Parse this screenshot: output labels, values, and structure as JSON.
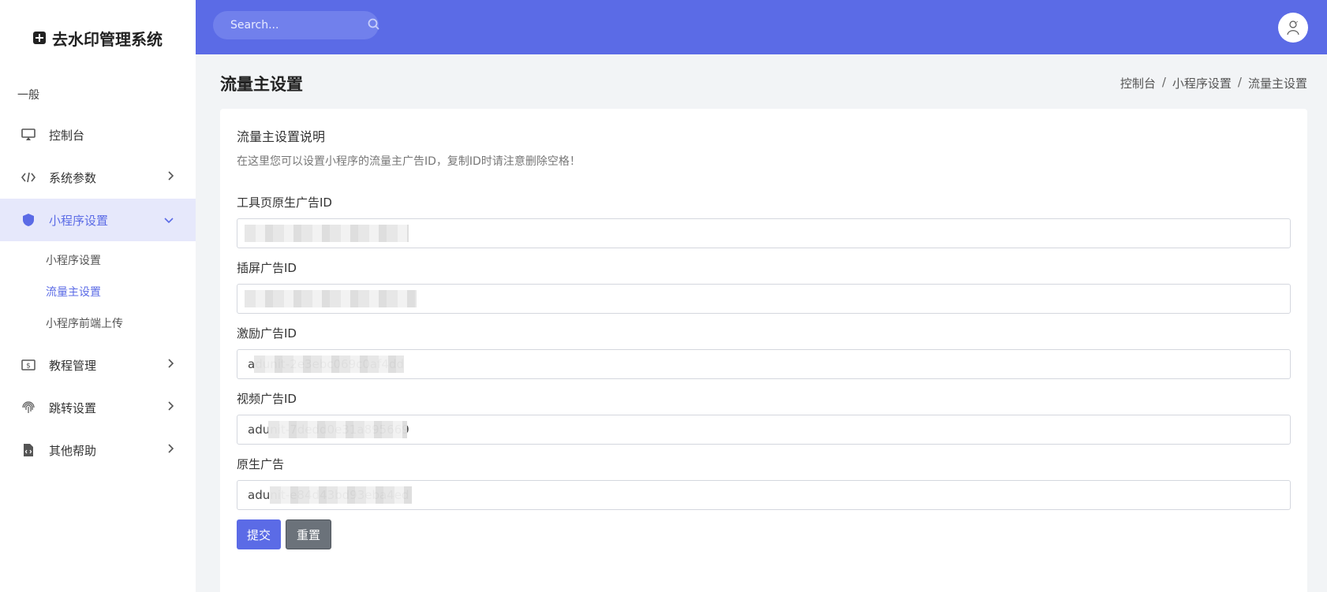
{
  "app": {
    "title": "去水印管理系统"
  },
  "sidebar": {
    "section": "一般",
    "items": [
      {
        "label": "控制台"
      },
      {
        "label": "系统参数"
      },
      {
        "label": "小程序设置"
      },
      {
        "label": "教程管理"
      },
      {
        "label": "跳转设置"
      },
      {
        "label": "其他帮助"
      }
    ],
    "sub_items": [
      {
        "label": "小程序设置"
      },
      {
        "label": "流量主设置"
      },
      {
        "label": "小程序前端上传"
      }
    ]
  },
  "header": {
    "search_placeholder": "Search..."
  },
  "page": {
    "title": "流量主设置",
    "breadcrumb": [
      "控制台",
      "小程序设置",
      "流量主设置"
    ]
  },
  "card": {
    "title": "流量主设置说明",
    "description": "在这里您可以设置小程序的流量主广告ID，复制ID时请注意删除空格！",
    "fields": [
      {
        "label": "工具页原生广告ID",
        "value": ""
      },
      {
        "label": "插屏广告ID",
        "value": ""
      },
      {
        "label": "激励广告ID",
        "value": "adunit-2e3ebc069c0af4dd"
      },
      {
        "label": "视频广告ID",
        "value": "adunit-7dedd0e31a895669"
      },
      {
        "label": "原生广告",
        "value": "adunit-e84d43bd93eba4ed"
      }
    ],
    "submit_label": "提交",
    "reset_label": "重置"
  },
  "colors": {
    "accent": "#5b6be6",
    "header": "#5b6be6",
    "secondary_button": "#6b727a"
  }
}
